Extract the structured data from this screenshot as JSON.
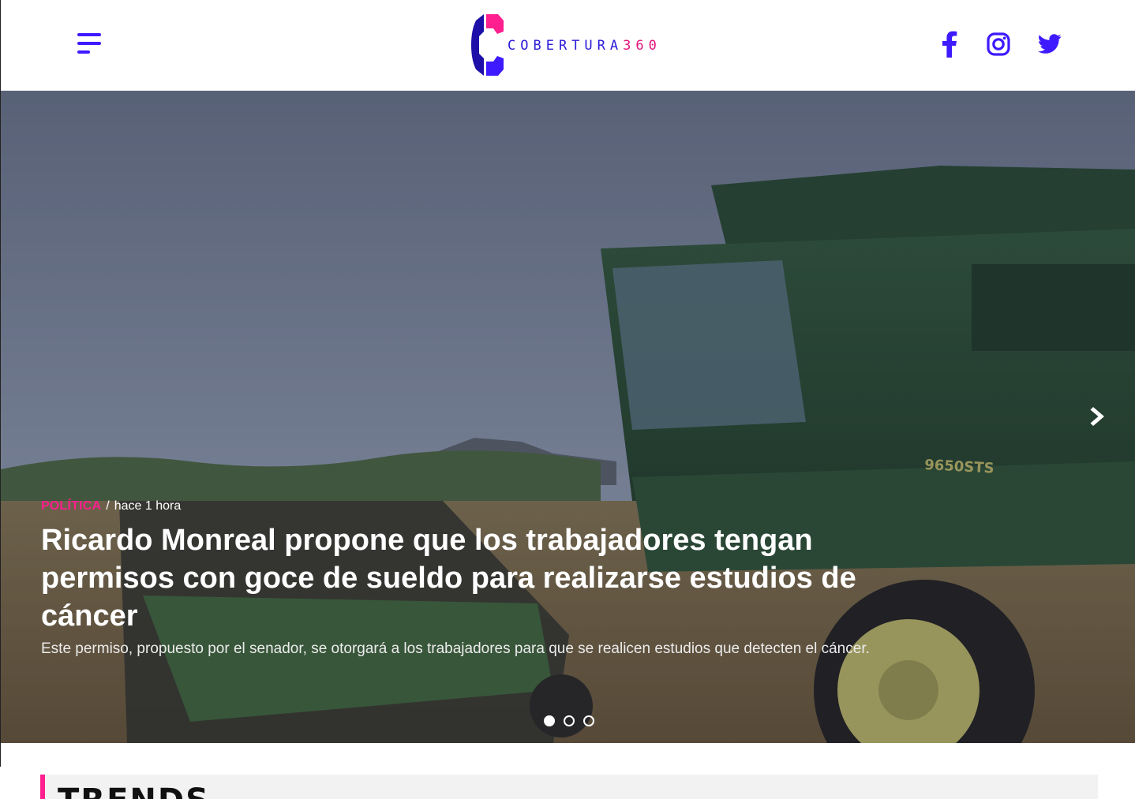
{
  "header": {
    "logo": {
      "name": "COBERTURA",
      "number": "360"
    },
    "menu_icon": "hamburger-menu-icon",
    "social": [
      {
        "name": "facebook",
        "icon": "facebook-icon"
      },
      {
        "name": "instagram",
        "icon": "instagram-icon"
      },
      {
        "name": "twitter",
        "icon": "twitter-icon"
      }
    ]
  },
  "hero": {
    "category": "POLÍTICA",
    "separator": "/",
    "time": "hace 1 hora",
    "title": "Ricardo Monreal propone que los trabajadores tengan permisos con goce de sueldo para realizarse estudios de cáncer",
    "excerpt": "Este permiso, propuesto por el senador, se otorgará a los trabajadores para que se realicen estudios que detecten el cáncer.",
    "next_icon": "chevron-right-icon",
    "slides_total": 3,
    "active_slide": 1,
    "image_text": "9650STS"
  },
  "trends": {
    "title": "TRENDS"
  },
  "colors": {
    "brand_blue": "#3d1aff",
    "brand_pink": "#ff1f8e",
    "logo_blue": "#2a1bd6"
  }
}
